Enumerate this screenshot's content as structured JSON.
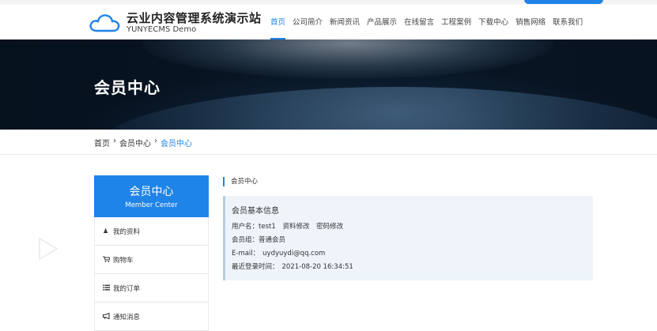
{
  "site": {
    "title": "云业内容管理系统演示站",
    "subtitle": "YUNYECMS  Demo"
  },
  "nav": {
    "items": [
      "首页",
      "公司简介",
      "新闻资讯",
      "产品展示",
      "在线留言",
      "工程案例",
      "下载中心",
      "销售网络",
      "联系我们"
    ],
    "active_index": 0
  },
  "banner": {
    "title": "会员中心"
  },
  "breadcrumb": {
    "home": "首页",
    "sep": "›",
    "parent": "会员中心",
    "current": "会员中心"
  },
  "sidebar": {
    "title": "会员中心",
    "subtitle": "Member Center",
    "items": [
      {
        "icon": "user-icon",
        "label": "我的资料"
      },
      {
        "icon": "cart-icon",
        "label": "购物车"
      },
      {
        "icon": "list-icon",
        "label": "我的订单"
      },
      {
        "icon": "bullhorn-icon",
        "label": "通知消息"
      }
    ]
  },
  "content": {
    "section_title": "会员中心",
    "box_title": "会员基本信息",
    "username_label": "用户名：",
    "username": "test1",
    "edit_profile": "资料修改",
    "change_password": "密码修改",
    "group_label": "会员组：",
    "group": "普通会员",
    "email_label": "E-mail：",
    "email": "uydyuydi@qq.com",
    "last_login_label": "最近登录时间：",
    "last_login": "2021-08-20 16:34:51"
  },
  "colors": {
    "accent": "#1f84e8"
  }
}
